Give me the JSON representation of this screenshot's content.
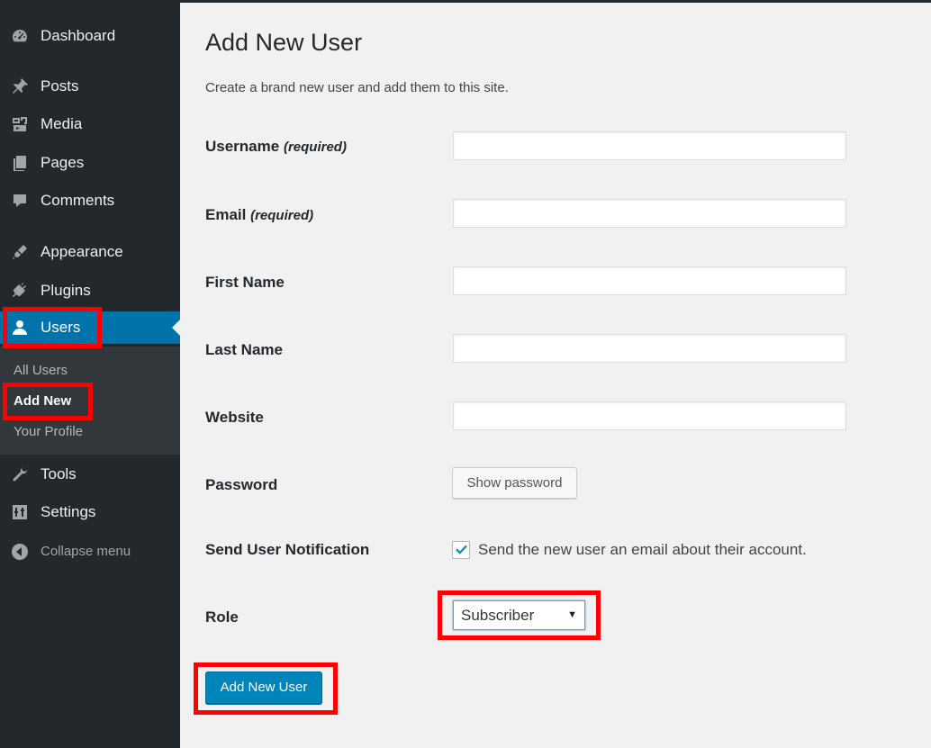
{
  "sidebar": {
    "menu": [
      {
        "label": "Dashboard",
        "icon": "dashboard-icon"
      },
      {
        "label": "Posts",
        "icon": "pin-icon"
      },
      {
        "label": "Media",
        "icon": "media-icon"
      },
      {
        "label": "Pages",
        "icon": "pages-icon"
      },
      {
        "label": "Comments",
        "icon": "comment-icon"
      },
      {
        "label": "Appearance",
        "icon": "brush-icon"
      },
      {
        "label": "Plugins",
        "icon": "plug-icon"
      },
      {
        "label": "Users",
        "icon": "user-icon",
        "active": true
      },
      {
        "label": "Tools",
        "icon": "wrench-icon"
      },
      {
        "label": "Settings",
        "icon": "settings-icon"
      },
      {
        "label": "Collapse menu",
        "icon": "collapse-icon"
      }
    ],
    "users_submenu": [
      {
        "label": "All Users"
      },
      {
        "label": "Add New",
        "current": true
      },
      {
        "label": "Your Profile"
      }
    ]
  },
  "page": {
    "title": "Add New User",
    "description": "Create a brand new user and add them to this site."
  },
  "form": {
    "username": {
      "label": "Username",
      "note": "(required)",
      "value": ""
    },
    "email": {
      "label": "Email",
      "note": "(required)",
      "value": ""
    },
    "first_name": {
      "label": "First Name",
      "value": ""
    },
    "last_name": {
      "label": "Last Name",
      "value": ""
    },
    "website": {
      "label": "Website",
      "value": ""
    },
    "password": {
      "label": "Password",
      "button": "Show password"
    },
    "notification": {
      "label": "Send User Notification",
      "checkbox_label": "Send the new user an email about their account.",
      "checked": true
    },
    "role": {
      "label": "Role",
      "selected": "Subscriber"
    },
    "submit": "Add New User"
  },
  "colors": {
    "sidebar_bg": "#23282d",
    "submenu_bg": "#32373c",
    "active_bg": "#0073aa",
    "primary_button": "#0085ba",
    "highlight": "#ff0000"
  }
}
